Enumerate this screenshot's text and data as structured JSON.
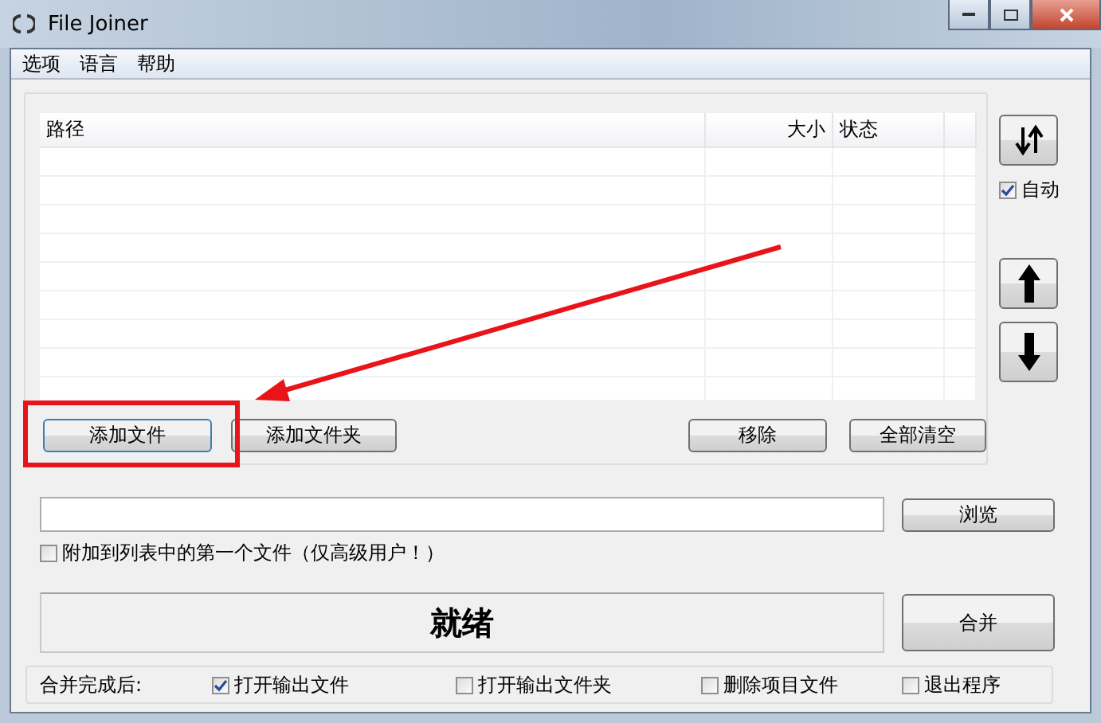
{
  "window": {
    "title": "File Joiner"
  },
  "menu": [
    "选项",
    "语言",
    "帮助"
  ],
  "table": {
    "columns": [
      "路径",
      "大小",
      "状态"
    ]
  },
  "auto": {
    "label": "自动",
    "checked": true
  },
  "buttons": [
    {
      "label": "添加文件",
      "focused": true
    },
    {
      "label": "添加文件夹",
      "focused": false
    },
    {
      "label": "移除",
      "focused": false
    },
    {
      "label": "全部清空",
      "focused": false
    }
  ],
  "browse": "浏览",
  "append_first": {
    "label": "附加到列表中的第一个文件（仅高级用户！）",
    "checked": false
  },
  "status": "就绪",
  "merge": "合并",
  "after_merge": {
    "label": "合并完成后:",
    "options": [
      {
        "label": "打开输出文件",
        "checked": true
      },
      {
        "label": "打开输出文件夹",
        "checked": false
      },
      {
        "label": "删除项目文件",
        "checked": false
      },
      {
        "label": "退出程序",
        "checked": false
      }
    ]
  }
}
